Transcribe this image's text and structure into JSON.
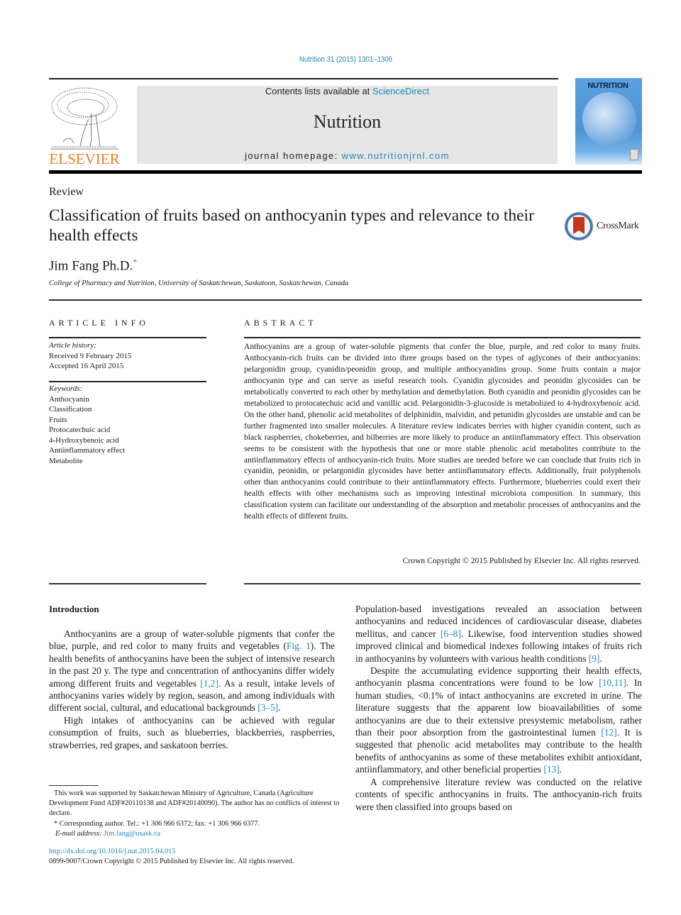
{
  "header": {
    "journal_ref": "Nutrition 31 (2015) 1301–1306",
    "contents_prefix": "Contents lists available at ",
    "contents_link": "ScienceDirect",
    "journal_name": "Nutrition",
    "homepage_prefix": "journal homepage: ",
    "homepage_link": "www.nutritionjrnl.com",
    "publisher_logo_text": "ELSEVIER",
    "cover_title": "NUTRITION"
  },
  "colors": {
    "link": "#1f8ab8",
    "elsevier_orange": "#f07d20",
    "masthead_bg": "#e6e6e6",
    "cover_blue": "#5aa0de",
    "crossmark_red": "#c8351f"
  },
  "article": {
    "type": "Review",
    "title": "Classification of fruits based on anthocyanin types and relevance to their health effects",
    "crossmark_label": "CrossMark",
    "author": "Jim Fang Ph.D.",
    "author_mark": "*",
    "affiliation": "College of Pharmacy and Nutrition, University of Saskatchewan, Saskatoon, Saskatchewan, Canada"
  },
  "article_info": {
    "heading": "ARTICLE INFO",
    "history_label": "Article history:",
    "received": "Received 9 February 2015",
    "accepted": "Accepted 16 April 2015",
    "keywords_label": "Keywords:",
    "keywords": [
      "Anthocyanin",
      "Classification",
      "Fruits",
      "Protocatechuic acid",
      "4-Hydroxybenoic acid",
      "Antiinflammatory effect",
      "Metabolite"
    ]
  },
  "abstract": {
    "heading": "ABSTRACT",
    "text": "Anthocyanins are a group of water-soluble pigments that confer the blue, purple, and red color to many fruits. Anthocyanin-rich fruits can be divided into three groups based on the types of aglycones of their anthocyanins: pelargonidin group, cyanidin/peonidin group, and multiple anthocyanidins group. Some fruits contain a major anthocyanin type and can serve as useful research tools. Cyanidin glycosides and peonidin glycosides can be metabolically converted to each other by methylation and demethylation. Both cyanidin and peonidin glycosides can be metabolized to protocatechuic acid and vanillic acid. Pelargonidin-3-glucoside is metabolized to 4-hydroxybenoic acid. On the other hand, phenolic acid metabolites of delphinidin, malvidin, and petunidin glycosides are unstable and can be further fragmented into smaller molecules. A literature review indicates berries with higher cyanidin content, such as black raspberries, chokeberries, and bilberries are more likely to produce an antiinflammatory effect. This observation seems to be consistent with the hypothesis that one or more stable phenolic acid metabolites contribute to the antiinflammatory effects of anthocyanin-rich fruits. More studies are needed before we can conclude that fruits rich in cyanidin, peonidin, or pelargonidin glycosides have better antiinflammatory effects. Additionally, fruit polyphenols other than anthocyanins could contribute to their antiinflammatory effects. Furthermore, blueberries could exert their health effects with other mechanisms such as improving intestinal microbiota composition. In summary, this classification system can facilitate our understanding of the absorption and metabolic processes of anthocyanins and the health effects of different fruits.",
    "copyright": "Crown Copyright © 2015 Published by Elsevier Inc. All rights reserved."
  },
  "body": {
    "intro_heading": "Introduction",
    "left": {
      "p1_a": "Anthocyanins are a group of water-soluble pigments that confer the blue, purple, and red color to many fruits and vegetables (",
      "p1_ref1": "Fig. 1",
      "p1_b": "). The health benefits of anthocyanins have been the subject of intensive research in the past 20 y. The type and concentration of anthocyanins differ widely among different fruits and vegetables ",
      "p1_ref2": "[1,2]",
      "p1_c": ". As a result, intake levels of anthocyanins varies widely by region, season, and among individuals with different social, cultural, and educational backgrounds ",
      "p1_ref3": "[3–5]",
      "p1_d": ".",
      "p2": "High intakes of anthocyanins can be achieved with regular consumption of fruits, such as blueberries, blackberries, raspberries, strawberries, red grapes, and saskatoon berries."
    },
    "right": {
      "p1_a": "Population-based investigations revealed an association between anthocyanins and reduced incidences of cardiovascular disease, diabetes mellitus, and cancer ",
      "p1_ref1": "[6–8]",
      "p1_b": ". Likewise, food intervention studies showed improved clinical and biomedical indexes following intakes of fruits rich in anthocyanins by volunteers with various health conditions ",
      "p1_ref2": "[9]",
      "p1_c": ".",
      "p2_a": "Despite the accumulating evidence supporting their health effects, anthocyanin plasma concentrations were found to be low ",
      "p2_ref1": "[10,11]",
      "p2_b": ". In human studies, <0.1% of intact anthocyanins are excreted in urine. The literature suggests that the apparent low bioavailabilities of some anthocyanins are due to their extensive presystemic metabolism, rather than their poor absorption from the gastrointestinal lumen ",
      "p2_ref2": "[12]",
      "p2_c": ". It is suggested that phenolic acid metabolites may contribute to the health benefits of anthocyanins as some of these metabolites exhibit antioxidant, antiinflammatory, and other beneficial properties ",
      "p2_ref3": "[13]",
      "p2_d": ".",
      "p3": "A comprehensive literature review was conducted on the relative contents of specific anthocyanins in fruits. The anthocyanin-rich fruits were then classified into groups based on"
    }
  },
  "footnotes": {
    "funding": "This work was supported by Saskatchewan Ministry of Agriculture, Canada (Agriculture Development Fund ADF#20110138 and ADF#20140090). The author has no conflicts of interest to declare.",
    "corresponding": "* Corresponding author. Tel.: +1 306 966 6372; fax: +1 306 966 6377.",
    "email_label": "E-mail address: ",
    "email": "Jim.fang@usask.ca",
    "doi": "http://dx.doi.org/10.1016/j.nut.2015.04.015",
    "issn": "0899-9007/Crown Copyright © 2015 Published by Elsevier Inc. All rights reserved."
  }
}
